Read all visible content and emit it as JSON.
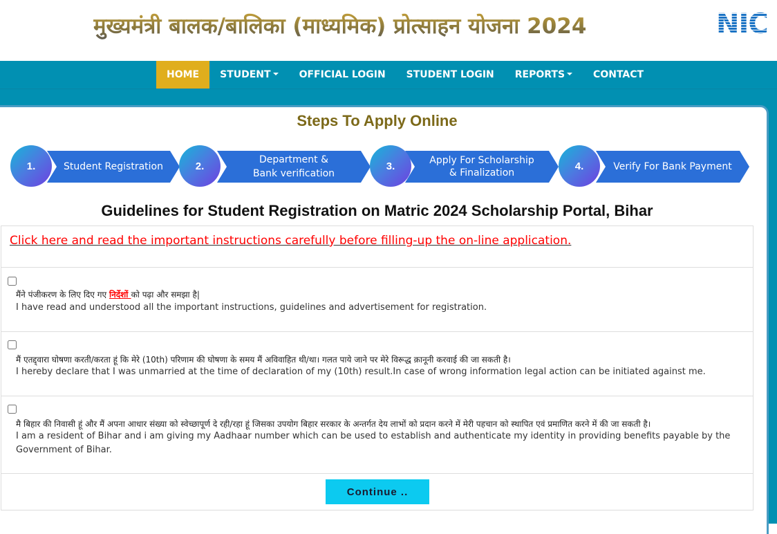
{
  "header": {
    "title": "मुख्यमंत्री बालक/बालिका (माध्यमिक) प्रोत्साहन योजना 2024",
    "logo_text": "NIC"
  },
  "nav": {
    "items": [
      {
        "label": "HOME",
        "active": true,
        "dropdown": false
      },
      {
        "label": "STUDENT",
        "active": false,
        "dropdown": true
      },
      {
        "label": "OFFICIAL LOGIN",
        "active": false,
        "dropdown": false
      },
      {
        "label": "STUDENT LOGIN",
        "active": false,
        "dropdown": false
      },
      {
        "label": "REPORTS",
        "active": false,
        "dropdown": true
      },
      {
        "label": "CONTACT",
        "active": false,
        "dropdown": false
      }
    ]
  },
  "steps": {
    "title": "Steps To Apply Online",
    "items": [
      {
        "number": "1.",
        "label_line1": "Student Registration",
        "label_line2": ""
      },
      {
        "number": "2.",
        "label_line1": "Department &",
        "label_line2": "Bank verification"
      },
      {
        "number": "3.",
        "label_line1": "Apply For Scholarship",
        "label_line2": "& Finalization"
      },
      {
        "number": "4.",
        "label_line1": "Verify For Bank Payment",
        "label_line2": ""
      }
    ]
  },
  "guidelines": {
    "title": "Guidelines for Student Registration on Matric 2024 Scholarship Portal, Bihar",
    "instructions_link": "Click here and read the important instructions carefully before filling-up the on-line application.",
    "declarations": [
      {
        "checked": false,
        "hindi_before": "मैंने पंजीकरण के लिए दिए गए ",
        "hindi_link": "निर्देशों ",
        "hindi_after": "को पढ़ा और समझा है|",
        "english": "I have read and understood all the important instructions, guidelines and advertisement for registration."
      },
      {
        "checked": false,
        "hindi": "मैं एतद्द्वारा घोषणा करती/करता हूं कि मेरे (10th) परिणाम की घोषणा के समय मैं अविवाहित थी/था। गलत पाये जाने पर मेरे विरूद्ध क़ानूनी करवाई की जा सकती है।",
        "english": "I hereby declare that I was unmarried at the time of declaration of my (10th) result.In case of wrong information legal action can be initiated against me."
      },
      {
        "checked": false,
        "hindi": "मै बिहार की निवासी हूं और मैं अपना आधार संख्या को स्वेच्छापूर्ण दे रही/रहा हूं जिसका उपयोग बिहार सरकार के अन्तर्गत देय लाभों को प्रदान करने में मेरी पहचान को स्थापित एवं प्रमाणित करने में की जा सकती है।",
        "english": "I am a resident of Bihar and i am giving my Aadhaar number which can be used to establish and authenticate my identity in providing benefits payable by the Government of Bihar."
      }
    ],
    "continue_label": "Continue .."
  },
  "colors": {
    "nav_bg": "#0190b2",
    "nav_active": "#e0ae1d",
    "step_blue": "#2b6fd8",
    "link_red": "#ff0000",
    "continue_btn": "#0ccaf0",
    "steps_title": "#7c6919"
  }
}
